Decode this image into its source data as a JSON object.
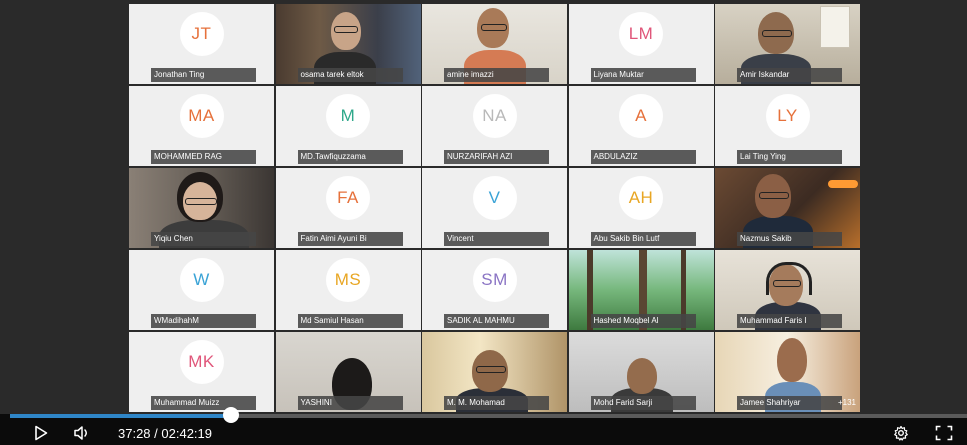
{
  "participants": [
    {
      "initials": "JT",
      "name": "Jonathan Ting",
      "color": "#e6713b",
      "video": null
    },
    {
      "initials": "",
      "name": "osama tarek eltok",
      "color": "",
      "video": "room-dark"
    },
    {
      "initials": "",
      "name": "amine imazzi",
      "color": "",
      "video": "room-light"
    },
    {
      "initials": "LM",
      "name": "Liyana Muktar",
      "color": "#e0567a",
      "video": null
    },
    {
      "initials": "",
      "name": "Amir Iskandar",
      "color": "",
      "video": "room-calendar"
    },
    {
      "initials": "MA",
      "name": "MOHAMMED RAG",
      "color": "#e6713b",
      "video": null
    },
    {
      "initials": "M",
      "name": "MD.Tawfiquzzama",
      "color": "#2ea88a",
      "video": null
    },
    {
      "initials": "NA",
      "name": "NURZARIFAH AZI",
      "color": "#b9b9b9",
      "video": null
    },
    {
      "initials": "A",
      "name": "ABDULAZIZ",
      "color": "#e6713b",
      "video": null
    },
    {
      "initials": "LY",
      "name": "Lai Ting Ying",
      "color": "#e6713b",
      "video": null
    },
    {
      "initials": "",
      "name": "Yiqiu Chen",
      "color": "",
      "video": "woman-glasses"
    },
    {
      "initials": "FA",
      "name": "Fatin Aimi Ayuni Bi",
      "color": "#e6713b",
      "video": null
    },
    {
      "initials": "V",
      "name": "Vincent",
      "color": "#3aa3d6",
      "video": null
    },
    {
      "initials": "AH",
      "name": "Abu Sakib Bin Lutf",
      "color": "#e8a623",
      "video": null
    },
    {
      "initials": "",
      "name": "Nazmus Sakib",
      "color": "",
      "video": "room-warm"
    },
    {
      "initials": "W",
      "name": "WMadihahM",
      "color": "#3aa3d6",
      "video": null
    },
    {
      "initials": "MS",
      "name": "Md Samiul Hasan",
      "color": "#e8a623",
      "video": null
    },
    {
      "initials": "SM",
      "name": "SADIK AL MAHMU",
      "color": "#8a74c4",
      "video": null
    },
    {
      "initials": "",
      "name": "Hashed Moqbel Al",
      "color": "",
      "video": "forest"
    },
    {
      "initials": "",
      "name": "Muhammad Faris I",
      "color": "",
      "video": "headphones"
    },
    {
      "initials": "MK",
      "name": "Muhammad Muizz",
      "color": "#e0567a",
      "video": null
    },
    {
      "initials": "",
      "name": "YASHINI",
      "color": "",
      "video": "dark-hair"
    },
    {
      "initials": "",
      "name": "M. M. Mohamad",
      "color": "",
      "video": "sunny-room"
    },
    {
      "initials": "",
      "name": "Mohd Farid Sarji",
      "color": "",
      "video": "grey-room"
    },
    {
      "initials": "",
      "name": "Jamee Shahriyar",
      "color": "",
      "video": "bright-window"
    }
  ],
  "overflow_count": "+131",
  "player": {
    "current_time": "37:28",
    "separator": " / ",
    "duration": "02:42:19",
    "progress": 0.2308,
    "accent": "#2f86c8"
  },
  "icons": {
    "play": "play-icon",
    "volume": "volume-icon",
    "settings": "gear-icon",
    "fullscreen": "fullscreen-icon"
  }
}
